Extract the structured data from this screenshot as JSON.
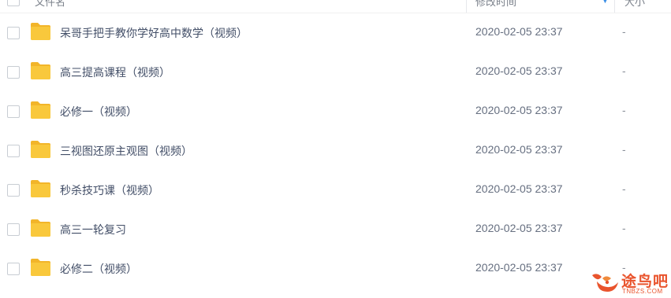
{
  "header": {
    "name_label": "文件名",
    "time_label": "修改时间",
    "size_label": "大小"
  },
  "files": [
    {
      "name": "呆哥手把手教你学好高中数学（视频）",
      "modified": "2020-02-05 23:37",
      "size": "-"
    },
    {
      "name": "高三提高课程（视频）",
      "modified": "2020-02-05 23:37",
      "size": "-"
    },
    {
      "name": "必修一（视频）",
      "modified": "2020-02-05 23:37",
      "size": "-"
    },
    {
      "name": "三视图还原主观图（视频）",
      "modified": "2020-02-05 23:37",
      "size": "-"
    },
    {
      "name": "秒杀技巧课（视频）",
      "modified": "2020-02-05 23:37",
      "size": "-"
    },
    {
      "name": "高三一轮复习",
      "modified": "2020-02-05 23:37",
      "size": "-"
    },
    {
      "name": "必修二（视频）",
      "modified": "2020-02-05 23:37",
      "size": "-"
    }
  ],
  "watermark": {
    "text": "途鸟吧",
    "sub": "TNBZS.COM"
  },
  "colors": {
    "folder": "#f9c83c",
    "folder_tab": "#f2b52a",
    "watermark": "#e9542d"
  },
  "icons": {
    "row": "folder-icon",
    "sort": "sort-down-icon"
  }
}
